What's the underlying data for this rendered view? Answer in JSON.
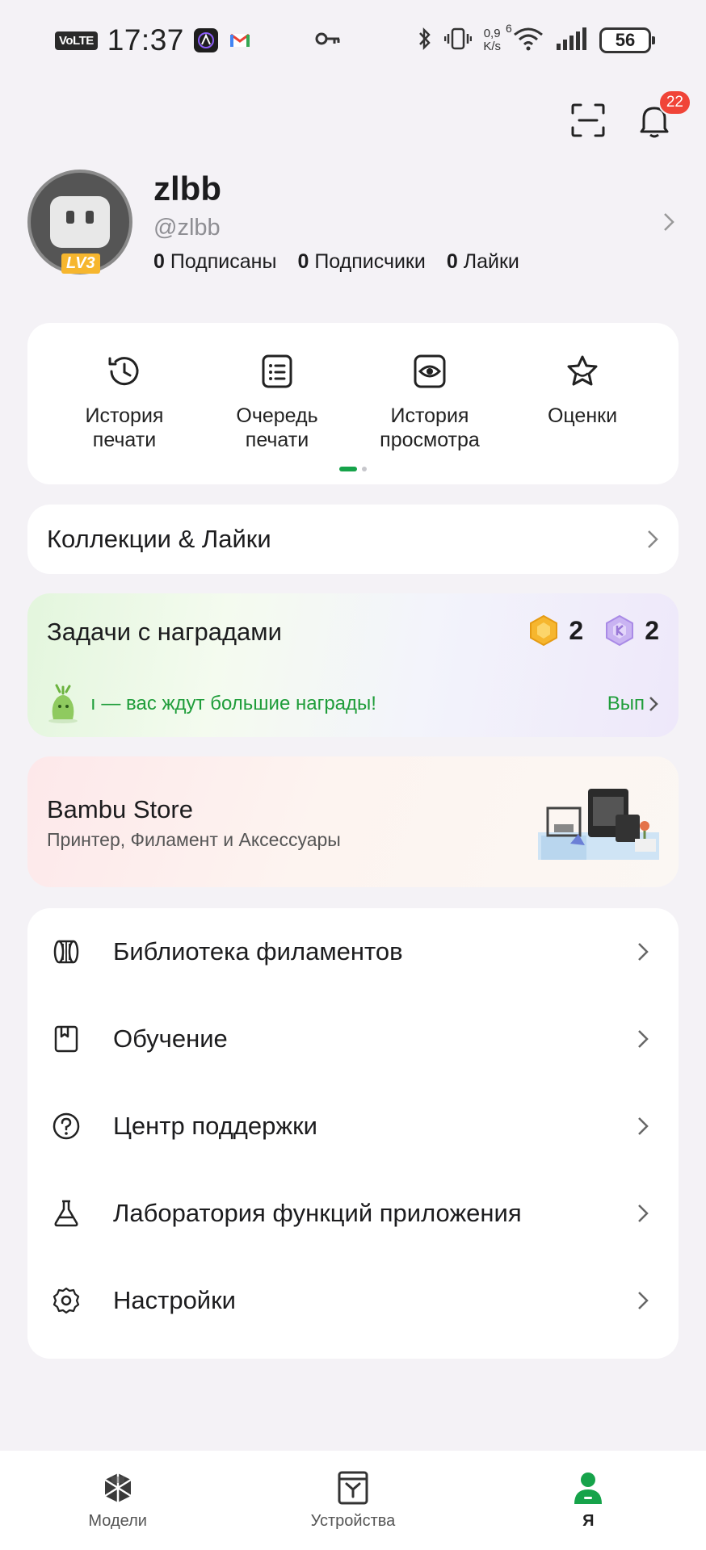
{
  "status_bar": {
    "volte": "VoLTE",
    "time": "17:37",
    "net_speed_top": "0,9",
    "net_speed_bottom": "K/s",
    "wifi_gen": "6",
    "battery": "56"
  },
  "header": {
    "notifications_count": "22"
  },
  "profile": {
    "name": "zlbb",
    "handle": "@zlbb",
    "level": "LV3",
    "following_count": "0",
    "following_label": "Подписаны",
    "followers_count": "0",
    "followers_label": "Подписчики",
    "likes_count": "0",
    "likes_label": "Лайки"
  },
  "quick_actions": [
    {
      "label": "История\nпечати",
      "icon": "history-icon"
    },
    {
      "label": "Очередь\nпечати",
      "icon": "list-icon"
    },
    {
      "label": "История\nпросмотра",
      "icon": "eye-icon"
    },
    {
      "label": "Оценки",
      "icon": "star-icon"
    }
  ],
  "collections": {
    "title": "Коллекции & Лайки"
  },
  "tasks": {
    "title": "Задачи с наградами",
    "gold_count": "2",
    "purple_count": "2",
    "ticker": "ı — вас ждут большие награды!",
    "action": "Вып"
  },
  "store": {
    "title": "Bambu Store",
    "subtitle": "Принтер, Филамент и Аксессуары"
  },
  "menu": [
    {
      "label": "Библиотека филаментов",
      "icon": "filament-icon"
    },
    {
      "label": "Обучение",
      "icon": "book-icon"
    },
    {
      "label": "Центр поддержки",
      "icon": "help-icon"
    },
    {
      "label": "Лаборатория функций приложения",
      "icon": "flask-icon"
    },
    {
      "label": "Настройки",
      "icon": "gear-icon"
    }
  ],
  "bottom_nav": [
    {
      "label": "Модели",
      "icon": "models-icon"
    },
    {
      "label": "Устройства",
      "icon": "devices-icon"
    },
    {
      "label": "Я",
      "icon": "person-icon",
      "active": true
    }
  ],
  "colors": {
    "accent": "#16a34a",
    "badge": "#f04438",
    "background": "#f4f2f6"
  }
}
